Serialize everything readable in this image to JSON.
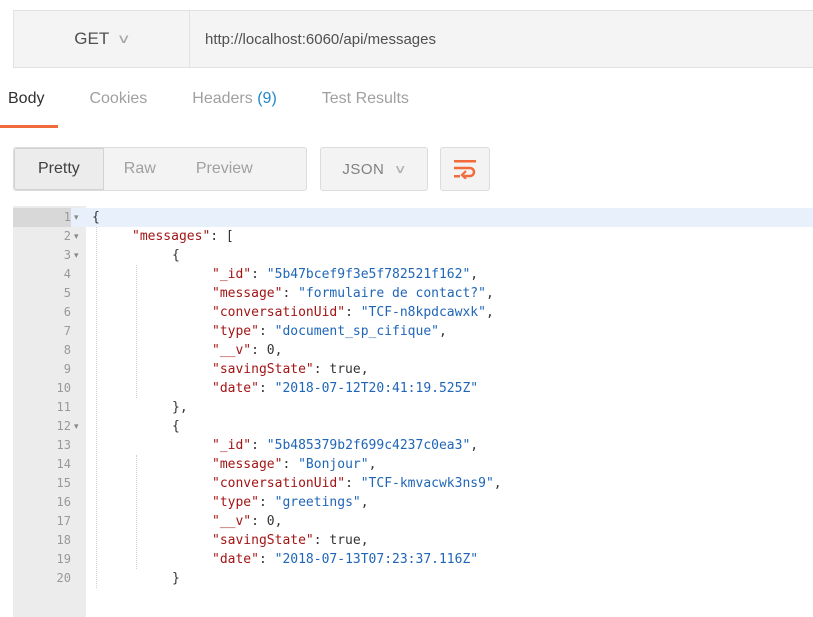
{
  "request": {
    "method": "GET",
    "url": "http://localhost:6060/api/messages"
  },
  "tabs": [
    {
      "label": "Body",
      "active": true
    },
    {
      "label": "Cookies"
    },
    {
      "label": "Headers",
      "count": "(9)"
    },
    {
      "label": "Test Results"
    }
  ],
  "toolbar": {
    "views": [
      "Pretty",
      "Raw",
      "Preview"
    ],
    "format": "JSON",
    "wrap_icon": "wrap-lines-icon"
  },
  "colors": {
    "accent": "#f26b3a",
    "key": "#a31515",
    "string": "#2066b8",
    "count": "#1e88c8"
  },
  "editor": {
    "lines": [
      {
        "n": "1",
        "fold": true,
        "indent": 0,
        "parts": [
          [
            "p",
            "{"
          ]
        ]
      },
      {
        "n": "2",
        "fold": true,
        "indent": 1,
        "parts": [
          [
            "k",
            "\"messages\""
          ],
          [
            "p",
            ": ["
          ]
        ]
      },
      {
        "n": "3",
        "fold": true,
        "indent": 2,
        "parts": [
          [
            "p",
            "{"
          ]
        ]
      },
      {
        "n": "4",
        "indent": 3,
        "parts": [
          [
            "k",
            "\"_id\""
          ],
          [
            "p",
            ": "
          ],
          [
            "s",
            "\"5b47bcef9f3e5f782521f162\""
          ],
          [
            "p",
            ","
          ]
        ]
      },
      {
        "n": "5",
        "indent": 3,
        "parts": [
          [
            "k",
            "\"message\""
          ],
          [
            "p",
            ": "
          ],
          [
            "s",
            "\"formulaire de contact?\""
          ],
          [
            "p",
            ","
          ]
        ]
      },
      {
        "n": "6",
        "indent": 3,
        "parts": [
          [
            "k",
            "\"conversationUid\""
          ],
          [
            "p",
            ": "
          ],
          [
            "s",
            "\"TCF-n8kpdcawxk\""
          ],
          [
            "p",
            ","
          ]
        ]
      },
      {
        "n": "7",
        "indent": 3,
        "parts": [
          [
            "k",
            "\"type\""
          ],
          [
            "p",
            ": "
          ],
          [
            "s",
            "\"document_sp_cifique\""
          ],
          [
            "p",
            ","
          ]
        ]
      },
      {
        "n": "8",
        "indent": 3,
        "parts": [
          [
            "k",
            "\"__v\""
          ],
          [
            "p",
            ": "
          ],
          [
            "n",
            "0"
          ],
          [
            "p",
            ","
          ]
        ]
      },
      {
        "n": "9",
        "indent": 3,
        "parts": [
          [
            "k",
            "\"savingState\""
          ],
          [
            "p",
            ": "
          ],
          [
            "n",
            "true"
          ],
          [
            "p",
            ","
          ]
        ]
      },
      {
        "n": "10",
        "indent": 3,
        "parts": [
          [
            "k",
            "\"date\""
          ],
          [
            "p",
            ": "
          ],
          [
            "s",
            "\"2018-07-12T20:41:19.525Z\""
          ]
        ]
      },
      {
        "n": "11",
        "indent": 2,
        "parts": [
          [
            "p",
            "},"
          ]
        ]
      },
      {
        "n": "12",
        "fold": true,
        "indent": 2,
        "parts": [
          [
            "p",
            "{"
          ]
        ]
      },
      {
        "n": "13",
        "indent": 3,
        "parts": [
          [
            "k",
            "\"_id\""
          ],
          [
            "p",
            ": "
          ],
          [
            "s",
            "\"5b485379b2f699c4237c0ea3\""
          ],
          [
            "p",
            ","
          ]
        ]
      },
      {
        "n": "14",
        "indent": 3,
        "parts": [
          [
            "k",
            "\"message\""
          ],
          [
            "p",
            ": "
          ],
          [
            "s",
            "\"Bonjour\""
          ],
          [
            "p",
            ","
          ]
        ]
      },
      {
        "n": "15",
        "indent": 3,
        "parts": [
          [
            "k",
            "\"conversationUid\""
          ],
          [
            "p",
            ": "
          ],
          [
            "s",
            "\"TCF-kmvacwk3ns9\""
          ],
          [
            "p",
            ","
          ]
        ]
      },
      {
        "n": "16",
        "indent": 3,
        "parts": [
          [
            "k",
            "\"type\""
          ],
          [
            "p",
            ": "
          ],
          [
            "s",
            "\"greetings\""
          ],
          [
            "p",
            ","
          ]
        ]
      },
      {
        "n": "17",
        "indent": 3,
        "parts": [
          [
            "k",
            "\"__v\""
          ],
          [
            "p",
            ": "
          ],
          [
            "n",
            "0"
          ],
          [
            "p",
            ","
          ]
        ]
      },
      {
        "n": "18",
        "indent": 3,
        "parts": [
          [
            "k",
            "\"savingState\""
          ],
          [
            "p",
            ": "
          ],
          [
            "n",
            "true"
          ],
          [
            "p",
            ","
          ]
        ]
      },
      {
        "n": "19",
        "indent": 3,
        "parts": [
          [
            "k",
            "\"date\""
          ],
          [
            "p",
            ": "
          ],
          [
            "s",
            "\"2018-07-13T07:23:37.116Z\""
          ]
        ]
      },
      {
        "n": "20",
        "indent": 2,
        "parts": [
          [
            "p",
            "}"
          ]
        ]
      }
    ]
  }
}
